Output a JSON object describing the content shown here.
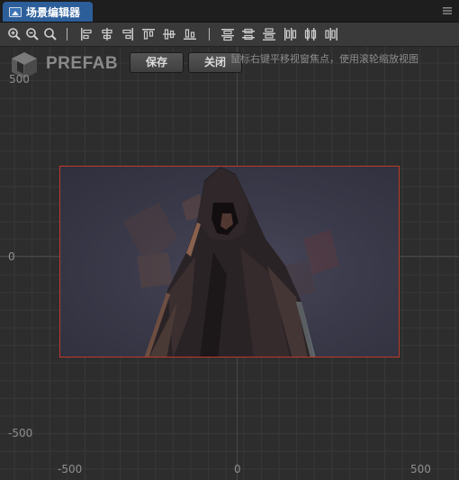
{
  "tab": {
    "title": "场景编辑器",
    "icon": "scene-image-icon"
  },
  "panel": {
    "menu_icon": "hamburger-menu-icon"
  },
  "toolbar": {
    "icons": [
      "zoom-in-icon",
      "zoom-out-icon",
      "zoom-reset-icon",
      "align-left-icon",
      "align-hcenter-icon",
      "align-right-icon",
      "align-top-icon",
      "align-vcenter-icon",
      "align-bottom-icon",
      "distribute-top-icon",
      "distribute-vcenter-icon",
      "distribute-bottom-icon",
      "distribute-left-icon",
      "distribute-hcenter-icon",
      "distribute-right-icon"
    ]
  },
  "prefab": {
    "label": "PREFAB",
    "save_label": "保存",
    "close_label": "关闭"
  },
  "hint": "鼠标右键平移视窗焦点，使用滚轮缩放视图",
  "axis_labels": {
    "y_top": "500",
    "y_zero": "0",
    "y_bottom": "-500",
    "x_left": "-500",
    "x_zero": "0",
    "x_right": "500"
  },
  "colors": {
    "tab_active": "#2c5f9a",
    "bounds_border": "#c0392b",
    "background": "#2b2b2b"
  }
}
